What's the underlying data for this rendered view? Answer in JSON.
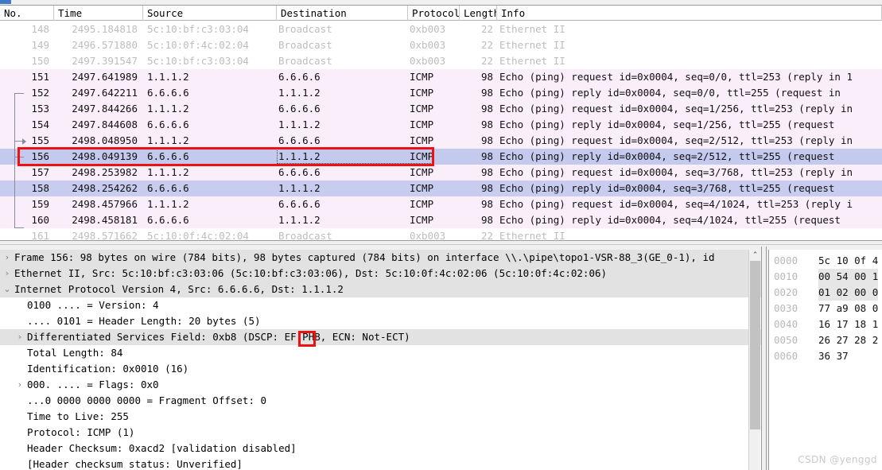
{
  "packet_list": {
    "columns": [
      {
        "key": "no",
        "label": "No."
      },
      {
        "key": "time",
        "label": "Time"
      },
      {
        "key": "source",
        "label": "Source"
      },
      {
        "key": "destination",
        "label": "Destination"
      },
      {
        "key": "protocol",
        "label": "Protocol"
      },
      {
        "key": "length",
        "label": "Length"
      },
      {
        "key": "info",
        "label": "Info"
      }
    ],
    "rows": [
      {
        "no": "148",
        "time": "2495.184818",
        "source": "5c:10:bf:c3:03:04",
        "destination": "Broadcast",
        "protocol": "0xb003",
        "length": "22",
        "info": "Ethernet II",
        "style": "gray"
      },
      {
        "no": "149",
        "time": "2496.571880",
        "source": "5c:10:0f:4c:02:04",
        "destination": "Broadcast",
        "protocol": "0xb003",
        "length": "22",
        "info": "Ethernet II",
        "style": "gray"
      },
      {
        "no": "150",
        "time": "2497.391547",
        "source": "5c:10:bf:c3:03:04",
        "destination": "Broadcast",
        "protocol": "0xb003",
        "length": "22",
        "info": "Ethernet II",
        "style": "gray"
      },
      {
        "no": "151",
        "time": "2497.641989",
        "source": "1.1.1.2",
        "destination": "6.6.6.6",
        "protocol": "ICMP",
        "length": "98",
        "info": "Echo (ping) request  id=0x0004, seq=0/0, ttl=253 (reply in 1",
        "style": "pink"
      },
      {
        "no": "152",
        "time": "2497.642211",
        "source": "6.6.6.6",
        "destination": "1.1.1.2",
        "protocol": "ICMP",
        "length": "98",
        "info": "Echo (ping) reply    id=0x0004, seq=0/0, ttl=255 (request in",
        "style": "pink"
      },
      {
        "no": "153",
        "time": "2497.844266",
        "source": "1.1.1.2",
        "destination": "6.6.6.6",
        "protocol": "ICMP",
        "length": "98",
        "info": "Echo (ping) request  id=0x0004, seq=1/256, ttl=253 (reply in",
        "style": "pink"
      },
      {
        "no": "154",
        "time": "2497.844608",
        "source": "6.6.6.6",
        "destination": "1.1.1.2",
        "protocol": "ICMP",
        "length": "98",
        "info": "Echo (ping) reply    id=0x0004, seq=1/256, ttl=255 (request",
        "style": "pink"
      },
      {
        "no": "155",
        "time": "2498.048950",
        "source": "1.1.1.2",
        "destination": "6.6.6.6",
        "protocol": "ICMP",
        "length": "98",
        "info": "Echo (ping) request  id=0x0004, seq=2/512, ttl=253 (reply in",
        "style": "pink"
      },
      {
        "no": "156",
        "time": "2498.049139",
        "source": "6.6.6.6",
        "destination": "1.1.1.2",
        "protocol": "ICMP",
        "length": "98",
        "info": "Echo (ping) reply    id=0x0004, seq=2/512, ttl=255 (request",
        "style": "selected"
      },
      {
        "no": "157",
        "time": "2498.253982",
        "source": "1.1.1.2",
        "destination": "6.6.6.6",
        "protocol": "ICMP",
        "length": "98",
        "info": "Echo (ping) request  id=0x0004, seq=3/768, ttl=253 (reply in",
        "style": "pink"
      },
      {
        "no": "158",
        "time": "2498.254262",
        "source": "6.6.6.6",
        "destination": "1.1.1.2",
        "protocol": "ICMP",
        "length": "98",
        "info": "Echo (ping) reply    id=0x0004, seq=3/768, ttl=255 (request",
        "style": "blue"
      },
      {
        "no": "159",
        "time": "2498.457966",
        "source": "1.1.1.2",
        "destination": "6.6.6.6",
        "protocol": "ICMP",
        "length": "98",
        "info": "Echo (ping) request  id=0x0004, seq=4/1024, ttl=253 (reply i",
        "style": "pink"
      },
      {
        "no": "160",
        "time": "2498.458181",
        "source": "6.6.6.6",
        "destination": "1.1.1.2",
        "protocol": "ICMP",
        "length": "98",
        "info": "Echo (ping) reply    id=0x0004, seq=4/1024, ttl=255 (request",
        "style": "pink"
      },
      {
        "no": "161",
        "time": "2498.571662",
        "source": "5c:10:0f:4c:02:04",
        "destination": "Broadcast",
        "protocol": "0xb003",
        "length": "22",
        "info": "Ethernet II",
        "style": "gray"
      }
    ],
    "selected_row_no": "156"
  },
  "detail_pane": {
    "lines": [
      {
        "indent": 0,
        "twisty": "collapsed",
        "text": "Frame 156: 98 bytes on wire (784 bits), 98 bytes captured (784 bits) on interface \\\\.\\pipe\\topo1-VSR-88_3(GE_0-1), id",
        "highlight": true
      },
      {
        "indent": 0,
        "twisty": "collapsed",
        "text": "Ethernet II, Src: 5c:10:bf:c3:03:06 (5c:10:bf:c3:03:06), Dst: 5c:10:0f:4c:02:06 (5c:10:0f:4c:02:06)",
        "highlight": true
      },
      {
        "indent": 0,
        "twisty": "expanded",
        "text": "Internet Protocol Version 4, Src: 6.6.6.6, Dst: 1.1.1.2",
        "highlight": true
      },
      {
        "indent": 1,
        "twisty": "none",
        "text": "0100 .... = Version: 4",
        "highlight": false
      },
      {
        "indent": 1,
        "twisty": "none",
        "text": ".... 0101 = Header Length: 20 bytes (5)",
        "highlight": false
      },
      {
        "indent": 1,
        "twisty": "collapsed",
        "text": "Differentiated Services Field: 0xb8 (DSCP: EF PHB, ECN: Not-ECT)",
        "highlight": true
      },
      {
        "indent": 1,
        "twisty": "none",
        "text": "Total Length: 84",
        "highlight": false
      },
      {
        "indent": 1,
        "twisty": "none",
        "text": "Identification: 0x0010 (16)",
        "highlight": false
      },
      {
        "indent": 1,
        "twisty": "collapsed",
        "text": "000. .... = Flags: 0x0",
        "highlight": false
      },
      {
        "indent": 1,
        "twisty": "none",
        "text": "...0 0000 0000 0000 = Fragment Offset: 0",
        "highlight": false
      },
      {
        "indent": 1,
        "twisty": "none",
        "text": "Time to Live: 255",
        "highlight": false
      },
      {
        "indent": 1,
        "twisty": "none",
        "text": "Protocol: ICMP (1)",
        "highlight": false
      },
      {
        "indent": 1,
        "twisty": "none",
        "text": "Header Checksum: 0xacd2 [validation disabled]",
        "highlight": false
      },
      {
        "indent": 1,
        "twisty": "none",
        "text": "[Header checksum status: Unverified]",
        "highlight": false
      }
    ]
  },
  "hex_pane": {
    "rows": [
      {
        "offset": "0000",
        "bytes": "5c 10 0f 4",
        "highlight": false
      },
      {
        "offset": "0010",
        "bytes": "00 54 00 1",
        "highlight": true
      },
      {
        "offset": "0020",
        "bytes": "01 02 00 0",
        "highlight": true
      },
      {
        "offset": "0030",
        "bytes": "77 a9 08 0",
        "highlight": false
      },
      {
        "offset": "0040",
        "bytes": "16 17 18 1",
        "highlight": false
      },
      {
        "offset": "0050",
        "bytes": "26 27 28 2",
        "highlight": false
      },
      {
        "offset": "0060",
        "bytes": "36 37",
        "highlight": false
      }
    ]
  },
  "annotations": {
    "packet_row_highlight_label": "selected-packet-row-156",
    "dscp_value_highlight_label": "dscp-ef-value",
    "color": "#ee1111"
  },
  "watermark": {
    "text": "CSDN @yenggd"
  },
  "scrollbar": {
    "up_arrow_glyph": "⌃"
  },
  "icons": {
    "twisty_collapsed": "›",
    "twisty_expanded": "⌄"
  }
}
